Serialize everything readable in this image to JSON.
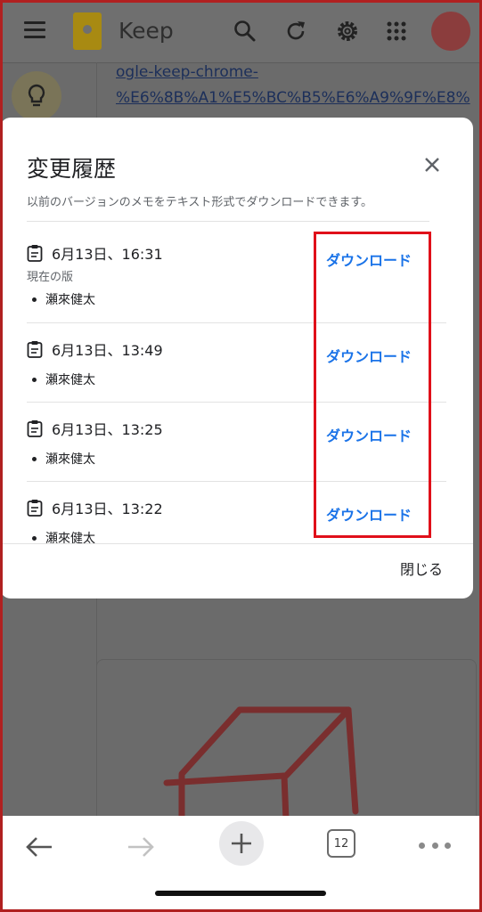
{
  "app": {
    "title": "Keep",
    "link_lines": [
      "ogle-keep-chrome-",
      "%E6%8B%A1%E5%BC%B5%E6%A9%9F%E8%"
    ]
  },
  "dialog": {
    "title": "変更履歴",
    "description": "以前のバージョンのメモをテキスト形式でダウンロードできます。",
    "close_label": "閉じる",
    "versions": [
      {
        "date": "6月13日、16:31",
        "status": "現在の版",
        "author": "瀬來健太",
        "download_label": "ダウンロード"
      },
      {
        "date": "6月13日、13:49",
        "author": "瀬來健太",
        "download_label": "ダウンロード"
      },
      {
        "date": "6月13日、13:25",
        "author": "瀬來健太",
        "download_label": "ダウンロード"
      },
      {
        "date": "6月13日、13:22",
        "author": "瀬來健太",
        "download_label": "ダウンロード"
      }
    ]
  },
  "browser": {
    "tab_count": "12"
  },
  "colors": {
    "accent": "#1a73e8",
    "highlight": "#e0101a",
    "overlay": "#6b6b6b"
  },
  "icons": [
    "menu-icon",
    "keep-logo",
    "search-icon",
    "refresh-icon",
    "gear-icon",
    "grid-icon",
    "lightbulb-icon",
    "close-icon",
    "clipboard-icon",
    "back-arrow-icon",
    "forward-arrow-icon",
    "plus-icon",
    "more-icon"
  ]
}
